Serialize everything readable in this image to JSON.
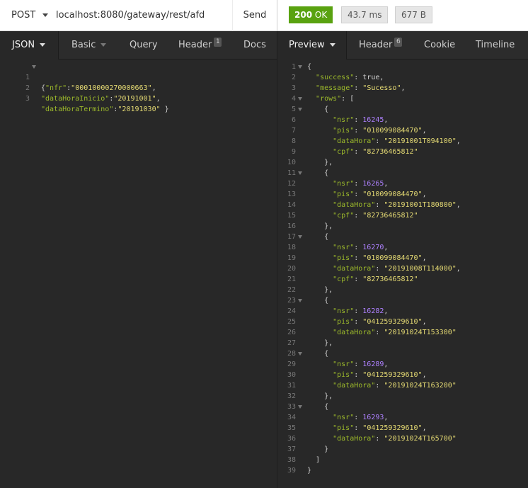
{
  "request": {
    "method": "POST",
    "url": "localhost:8080/gateway/rest/afd",
    "send_label": "Send"
  },
  "response": {
    "status_code": "200",
    "status_text": "OK",
    "time": "43.7 ms",
    "size": "677 B"
  },
  "left_tabs": {
    "body": "JSON",
    "auth": "Basic",
    "query": "Query",
    "header": "Header",
    "header_count": "1",
    "docs": "Docs"
  },
  "right_tabs": {
    "preview": "Preview",
    "header": "Header",
    "header_count": "6",
    "cookie": "Cookie",
    "timeline": "Timeline"
  },
  "request_body": {
    "nfr": "00010000270000663",
    "dataHoraInicio": "20191001",
    "dataHoraTermino": "20191030"
  },
  "response_body": {
    "success": "true",
    "message": "Sucesso",
    "rows": [
      {
        "nsr": "16245",
        "pis": "010099084470",
        "dataHora": "20191001T094100",
        "cpf": "82736465812"
      },
      {
        "nsr": "16265",
        "pis": "010099084470",
        "dataHora": "20191001T180800",
        "cpf": "82736465812"
      },
      {
        "nsr": "16270",
        "pis": "010099084470",
        "dataHora": "20191008T114000",
        "cpf": "82736465812"
      },
      {
        "nsr": "16282",
        "pis": "041259329610",
        "dataHora": "20191024T153300"
      },
      {
        "nsr": "16289",
        "pis": "041259329610",
        "dataHora": "20191024T163200"
      },
      {
        "nsr": "16293",
        "pis": "041259329610",
        "dataHora": "20191024T165700"
      }
    ]
  },
  "colors": {
    "status_ok": "#59a210",
    "json_key": "#9cb92b",
    "json_string": "#e6db74",
    "json_number": "#ae81ff",
    "editor_background": "#282828"
  }
}
